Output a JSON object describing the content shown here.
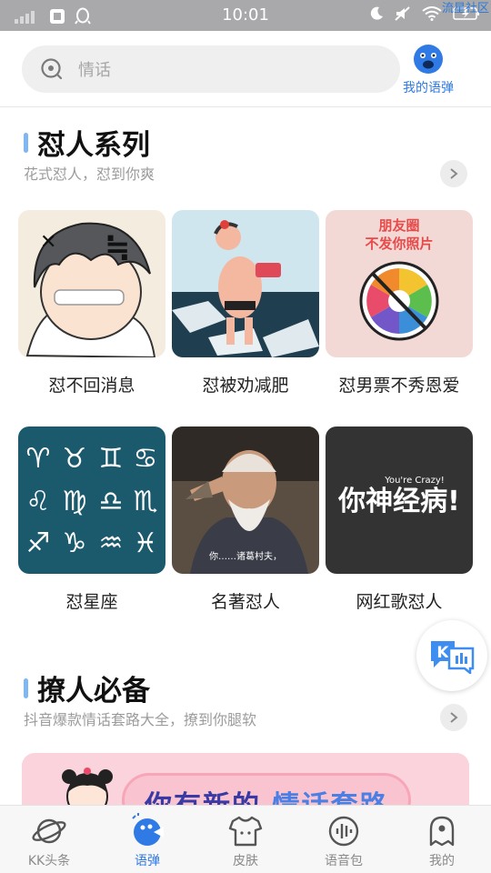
{
  "status_bar": {
    "time": "10:01",
    "watermark": "流星社区"
  },
  "header": {
    "search_placeholder": "情话",
    "my_voice_label": "我的语弹"
  },
  "sections": [
    {
      "title": "怼人系列",
      "subtitle": "花式怼人，怼到你爽",
      "cards": [
        {
          "label": "怼不回消息"
        },
        {
          "label": "怼被劝减肥"
        },
        {
          "label": "怼男票不秀恩爱",
          "thumb_text": "朋友圈\n不发你照片"
        },
        {
          "label": "怼星座"
        },
        {
          "label": "名著怼人",
          "thumb_text": "你……诸葛村夫，"
        },
        {
          "label": "网红歌怼人",
          "thumb_text": "你神经病!",
          "thumb_small": "You're Crazy!"
        }
      ]
    },
    {
      "title": "撩人必备",
      "subtitle": "抖音爆款情话套路大全，撩到你腿软",
      "banner_text_prefix": "你有新的",
      "banner_text_highlight": "情话套路"
    }
  ],
  "tabbar": {
    "tabs": [
      {
        "label": "KK头条",
        "icon": "planet-icon",
        "active": false
      },
      {
        "label": "语弹",
        "icon": "voice-bubble-icon",
        "active": true
      },
      {
        "label": "皮肤",
        "icon": "shirt-icon",
        "active": false
      },
      {
        "label": "语音包",
        "icon": "voice-pack-icon",
        "active": false
      },
      {
        "label": "我的",
        "icon": "ghost-profile-icon",
        "active": false
      }
    ]
  },
  "colors": {
    "accent": "#2f7ae5",
    "section_bar": "#7fb7f2",
    "status_bar": "#a9a9ab"
  }
}
